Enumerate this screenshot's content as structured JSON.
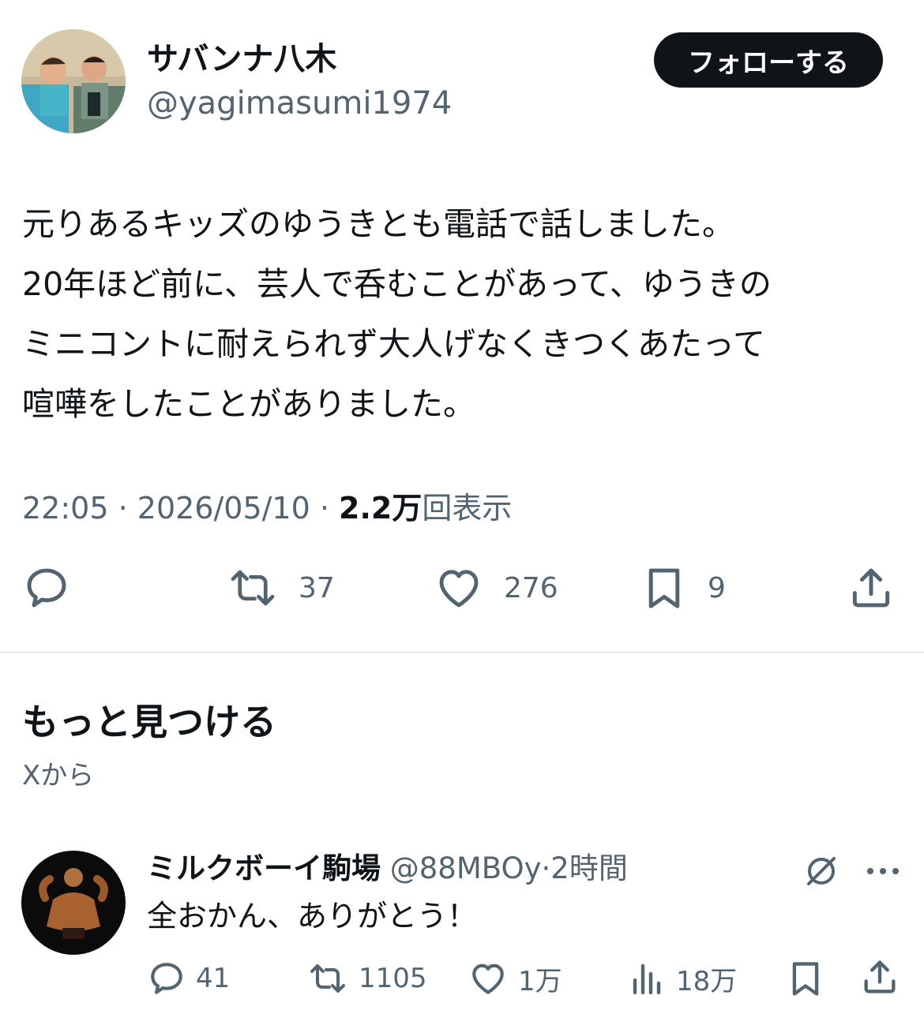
{
  "author": {
    "name": "サバンナ八木",
    "handle": "@yagimasumi1974",
    "follow_label": "フォローする"
  },
  "post": {
    "lines": [
      "元りあるキッズのゆうきとも電話で話しました。",
      "20年ほど前に、芸人で呑むことがあって、ゆうきの",
      "ミニコントに耐えられず大人げなくきつくあたって",
      "喧嘩をしたことがありました。"
    ],
    "time": "22:05",
    "date": "2026/05/10",
    "sep": " · ",
    "views_count": "2.2万",
    "views_label": "回表示"
  },
  "actions": {
    "reply_icon": "reply-icon",
    "retweets": "37",
    "likes": "276",
    "bookmarks": "9",
    "share_icon": "share-icon"
  },
  "discover": {
    "title": "もっと見つける",
    "subtitle": "Xから"
  },
  "suggested": {
    "name": "ミルクボーイ駒場",
    "handle": "@88MBOy",
    "sep": "·",
    "time": "2時間",
    "text": "全おかん、ありがとう！",
    "replies": "41",
    "retweets": "1105",
    "likes": "1万",
    "views": "18万"
  },
  "colors": {
    "text": "#0f1419",
    "secondary": "#536471",
    "divider": "#cfd9de",
    "button_bg": "#0f1419"
  }
}
